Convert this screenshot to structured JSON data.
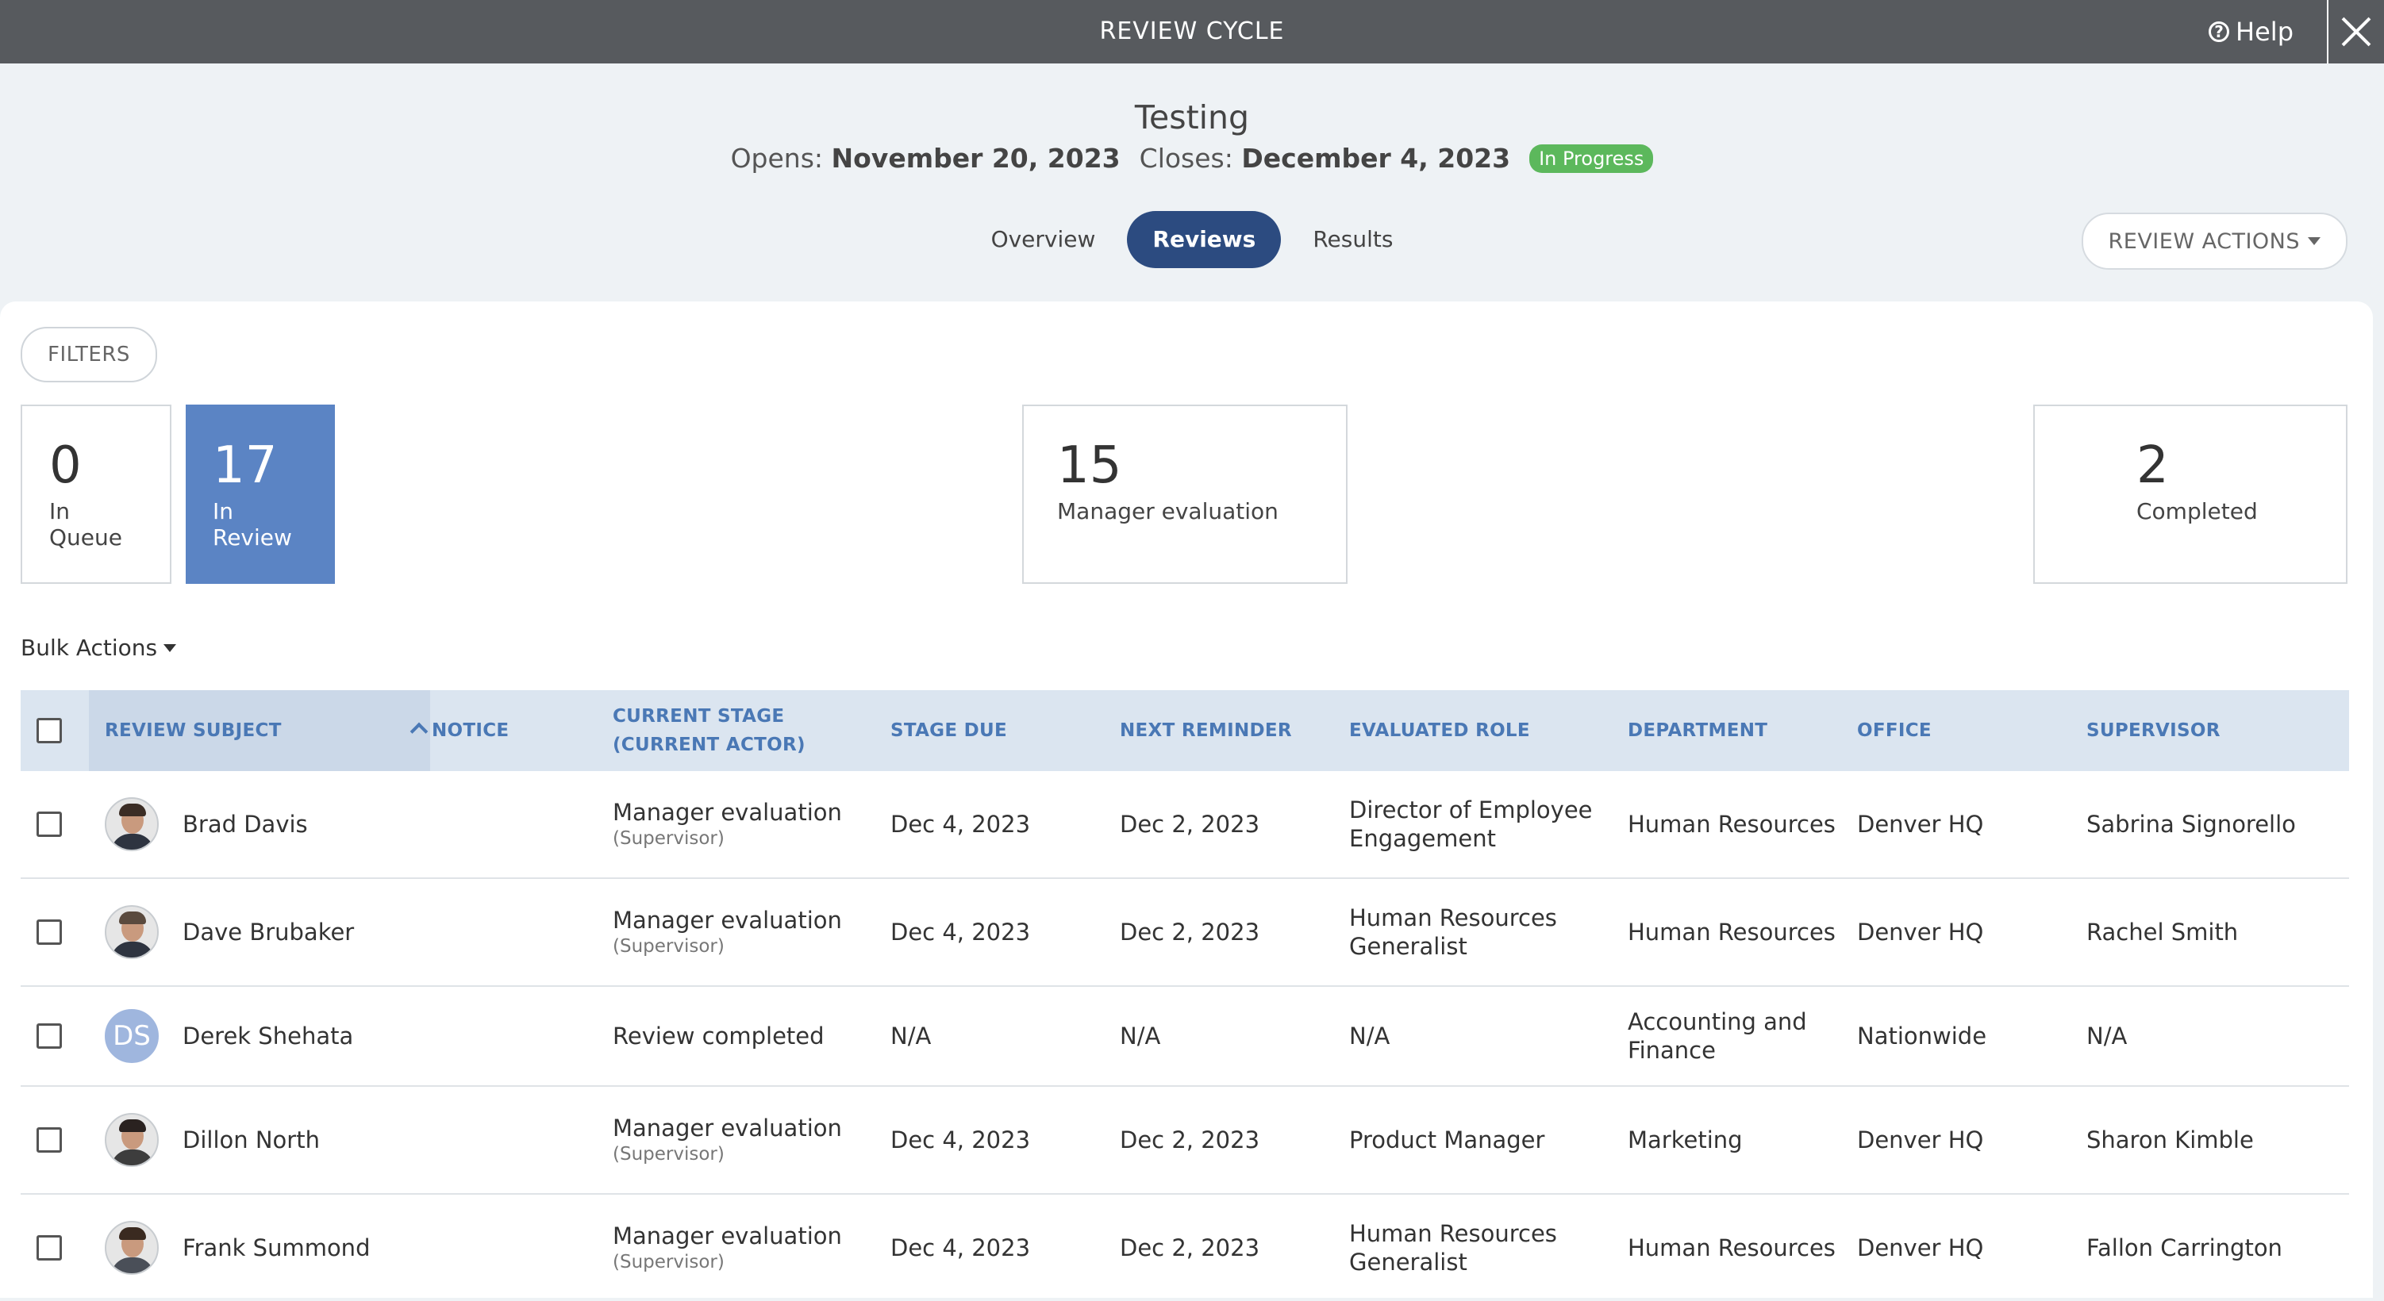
{
  "topbar": {
    "title": "REVIEW CYCLE",
    "help_label": "Help"
  },
  "cycle": {
    "name": "Testing",
    "opens_label": "Opens:",
    "opens_date": "November 20, 2023",
    "closes_label": "Closes:",
    "closes_date": "December 4, 2023",
    "status": "In Progress"
  },
  "tabs": [
    {
      "label": "Overview",
      "active": false
    },
    {
      "label": "Reviews",
      "active": true
    },
    {
      "label": "Results",
      "active": false
    }
  ],
  "review_actions_label": "REVIEW ACTIONS",
  "filters_label": "FILTERS",
  "stats": [
    {
      "value": "0",
      "label": "In Queue",
      "active": false
    },
    {
      "value": "17",
      "label": "In Review",
      "active": true
    },
    {
      "value": "15",
      "label": "Manager evaluation",
      "active": false
    },
    {
      "value": "2",
      "label": "Completed",
      "active": false
    }
  ],
  "bulk_actions_label": "Bulk Actions",
  "table": {
    "columns": {
      "review_subject": "REVIEW SUBJECT",
      "notice": "NOTICE",
      "current_stage_1": "CURRENT STAGE",
      "current_stage_2": "(CURRENT ACTOR)",
      "stage_due": "STAGE DUE",
      "next_reminder": "NEXT REMINDER",
      "evaluated_role": "EVALUATED ROLE",
      "department": "DEPARTMENT",
      "office": "OFFICE",
      "supervisor": "SUPERVISOR"
    },
    "rows": [
      {
        "name": "Brad Davis",
        "avatar": "photo",
        "stage": "Manager evaluation",
        "actor": "(Supervisor)",
        "due": "Dec 4, 2023",
        "reminder": "Dec 2, 2023",
        "role": "Director of Employee Engagement",
        "department": "Human Resources",
        "office": "Denver HQ",
        "supervisor": "Sabrina Signorello"
      },
      {
        "name": "Dave Brubaker",
        "avatar": "photo",
        "stage": "Manager evaluation",
        "actor": "(Supervisor)",
        "due": "Dec 4, 2023",
        "reminder": "Dec 2, 2023",
        "role": "Human Resources Generalist",
        "department": "Human Resources",
        "office": "Denver HQ",
        "supervisor": "Rachel Smith"
      },
      {
        "name": "Derek Shehata",
        "avatar": "DS",
        "stage": "Review completed",
        "actor": "",
        "due": "N/A",
        "reminder": "N/A",
        "role": "N/A",
        "department": "Accounting and Finance",
        "office": "Nationwide",
        "supervisor": "N/A"
      },
      {
        "name": "Dillon North",
        "avatar": "photo",
        "stage": "Manager evaluation",
        "actor": "(Supervisor)",
        "due": "Dec 4, 2023",
        "reminder": "Dec 2, 2023",
        "role": "Product Manager",
        "department": "Marketing",
        "office": "Denver HQ",
        "supervisor": "Sharon Kimble"
      },
      {
        "name": "Frank Summond",
        "avatar": "photo",
        "stage": "Manager evaluation",
        "actor": "(Supervisor)",
        "due": "Dec 4, 2023",
        "reminder": "Dec 2, 2023",
        "role": "Human Resources Generalist",
        "department": "Human Resources",
        "office": "Denver HQ",
        "supervisor": "Fallon Carrington"
      }
    ]
  }
}
